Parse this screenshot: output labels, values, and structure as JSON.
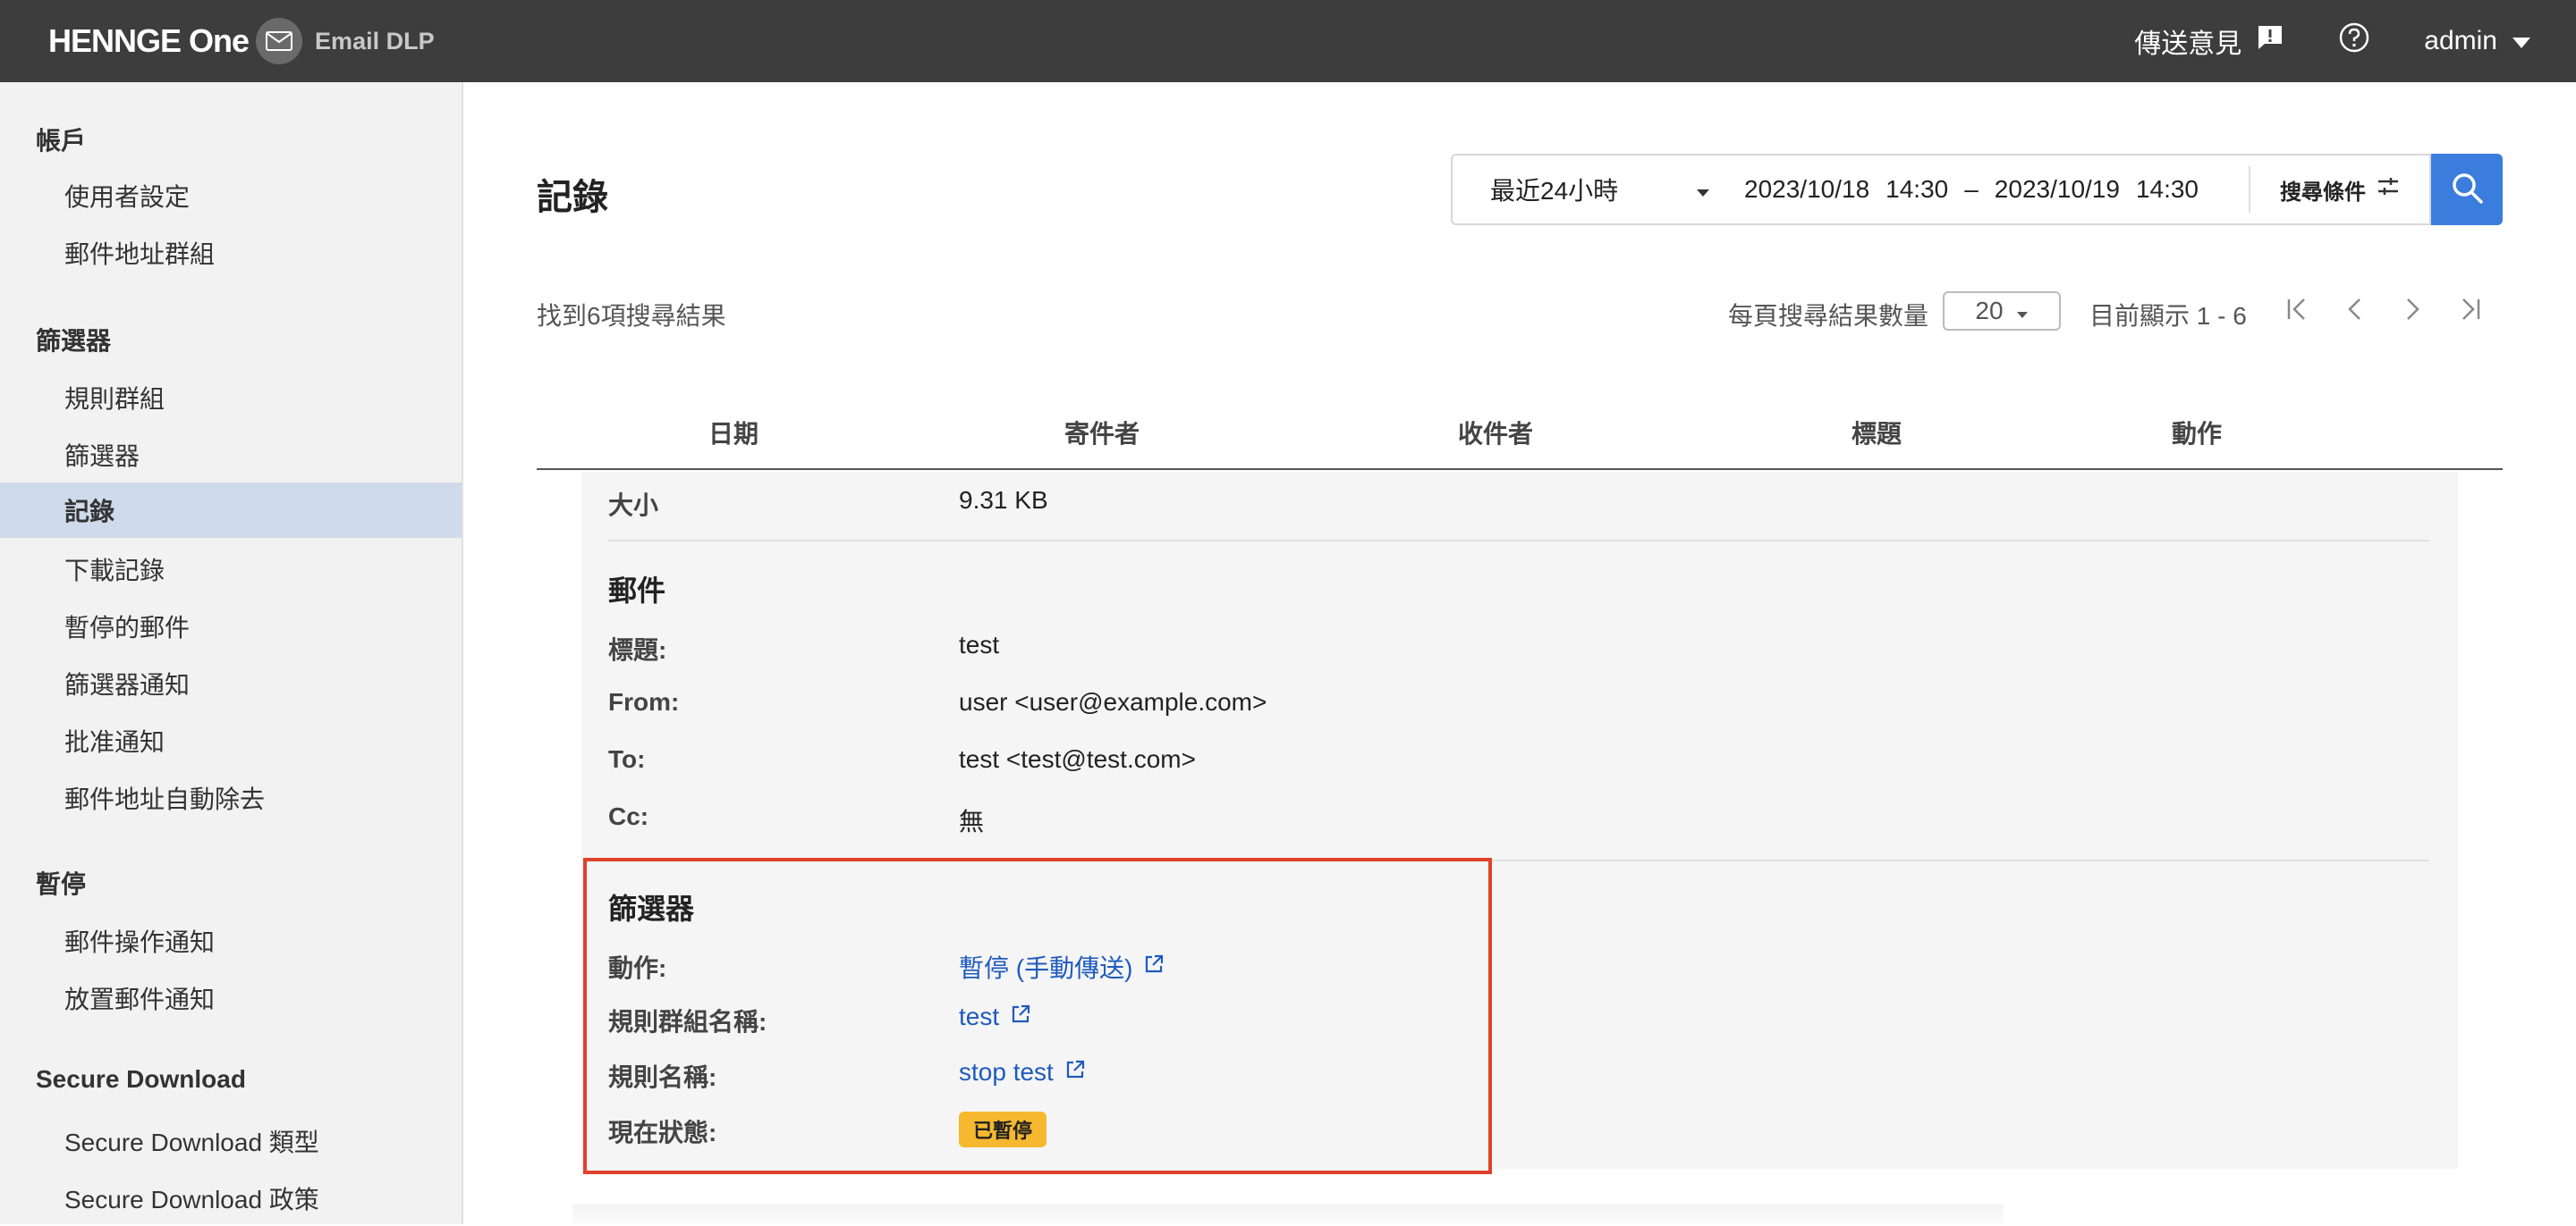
{
  "header": {
    "brand": "HENNGE One",
    "product": "Email DLP",
    "feedback": "傳送意見",
    "user": "admin"
  },
  "sidebar": {
    "groups": [
      {
        "title": "帳戶",
        "items": [
          "使用者設定",
          "郵件地址群組"
        ]
      },
      {
        "title": "篩選器",
        "items": [
          "規則群組",
          "篩選器",
          "記錄",
          "下載記錄",
          "暫停的郵件",
          "篩選器通知",
          "批准通知",
          "郵件地址自動除去"
        ]
      },
      {
        "title": "暫停",
        "items": [
          "郵件操作通知",
          "放置郵件通知"
        ]
      },
      {
        "title": "Secure Download",
        "items": [
          "Secure Download 類型",
          "Secure Download 政策"
        ]
      }
    ],
    "active": "記錄"
  },
  "page": {
    "title": "記錄",
    "search": {
      "range": "最近24小時",
      "from_date": "2023/10/18",
      "from_time": "14:30",
      "separator": "–",
      "to_date": "2023/10/19",
      "to_time": "14:30",
      "conditions": "搜尋條件"
    },
    "result_count": "找到6項搜尋結果",
    "per_page_label": "每頁搜尋結果數量",
    "per_page": "20",
    "showing": "目前顯示 1 - 6",
    "columns": [
      "日期",
      "寄件者",
      "收件者",
      "標題",
      "動作"
    ]
  },
  "detail": {
    "size_label": "大小",
    "size_value": "9.31 KB",
    "mail_section": "郵件",
    "subject_label": "標題:",
    "subject_value": "test",
    "from_label": "From:",
    "from_value": "user <user@example.com>",
    "to_label": "To:",
    "to_value": "test <test@test.com>",
    "cc_label": "Cc:",
    "cc_value": "無",
    "filter_section": "篩選器",
    "action_label": "動作:",
    "action_value": "暫停 (手動傳送)",
    "rule_group_label": "規則群組名稱:",
    "rule_group_value": "test",
    "rule_label": "規則名稱:",
    "rule_value": "stop test",
    "status_label": "現在狀態:",
    "status_value": "已暫停"
  },
  "colors": {
    "topbar": "#3d3d3d",
    "accent": "#3b7ddd",
    "link": "#1e5bbd",
    "badge": "#f5b82e",
    "highlight": "#e2402b"
  }
}
